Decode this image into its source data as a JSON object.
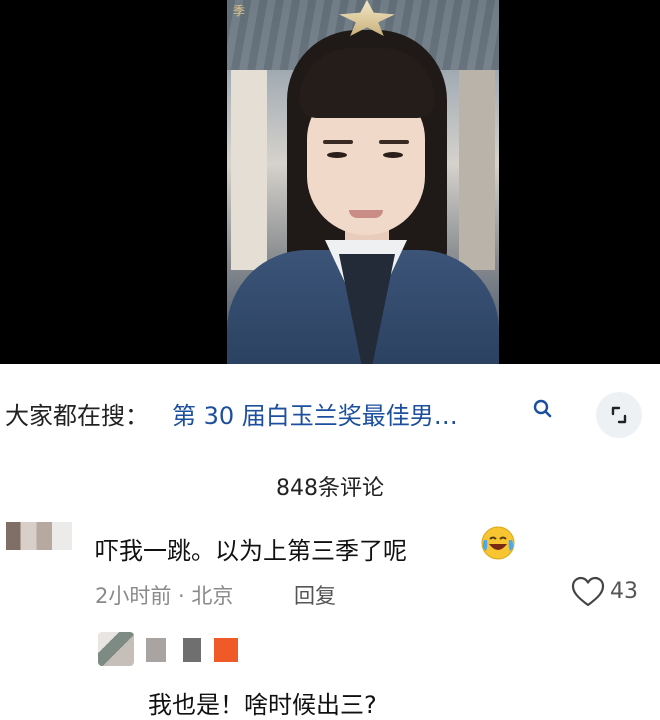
{
  "video": {
    "watermark": "季"
  },
  "search": {
    "prefix": "大家都在搜：",
    "query": "第 30 届白玉兰奖最佳男…",
    "search_icon": "search-icon",
    "expand_icon": "expand-icon"
  },
  "comments_header": {
    "count_label": "848条评论"
  },
  "comments": [
    {
      "text": "吓我一跳。以为上第三季了呢",
      "emoji": "laughing-crying-emoji",
      "time_location": "2小时前 · 北京",
      "reply_label": "回复",
      "likes": "43"
    },
    {
      "text": "我也是！啥时候出三?"
    }
  ],
  "colors": {
    "link": "#1d4f9f",
    "meta": "#8a8a8a",
    "emoji_yellow": "#f7c531"
  }
}
